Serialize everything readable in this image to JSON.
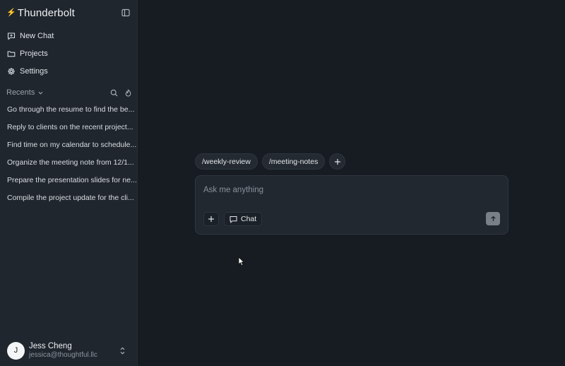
{
  "app": {
    "name": "Thunderbolt"
  },
  "sidebar": {
    "nav": [
      {
        "label": "New Chat",
        "icon": "new-chat-icon"
      },
      {
        "label": "Projects",
        "icon": "folder-icon"
      },
      {
        "label": "Settings",
        "icon": "gear-icon"
      }
    ],
    "recents_label": "Recents",
    "recents": [
      "Go through the resume to find the be...",
      "Reply to clients on the recent project...",
      "Find time on my calendar to schedule...",
      "Organize the meeting note from 12/1...",
      "Prepare the presentation slides for ne...",
      "Compile the project update for the cli..."
    ]
  },
  "user": {
    "initial": "J",
    "name": "Jess Cheng",
    "email": "jessica@thoughtful.llc"
  },
  "chips": [
    "/weekly-review",
    "/meeting-notes"
  ],
  "composer": {
    "placeholder": "Ask me anything",
    "mode_label": "Chat"
  },
  "colors": {
    "main_bg": "#171c23",
    "sidebar_bg": "#1f262e",
    "accent_bolt": "#f5b544",
    "send_button": "#7a8088"
  }
}
